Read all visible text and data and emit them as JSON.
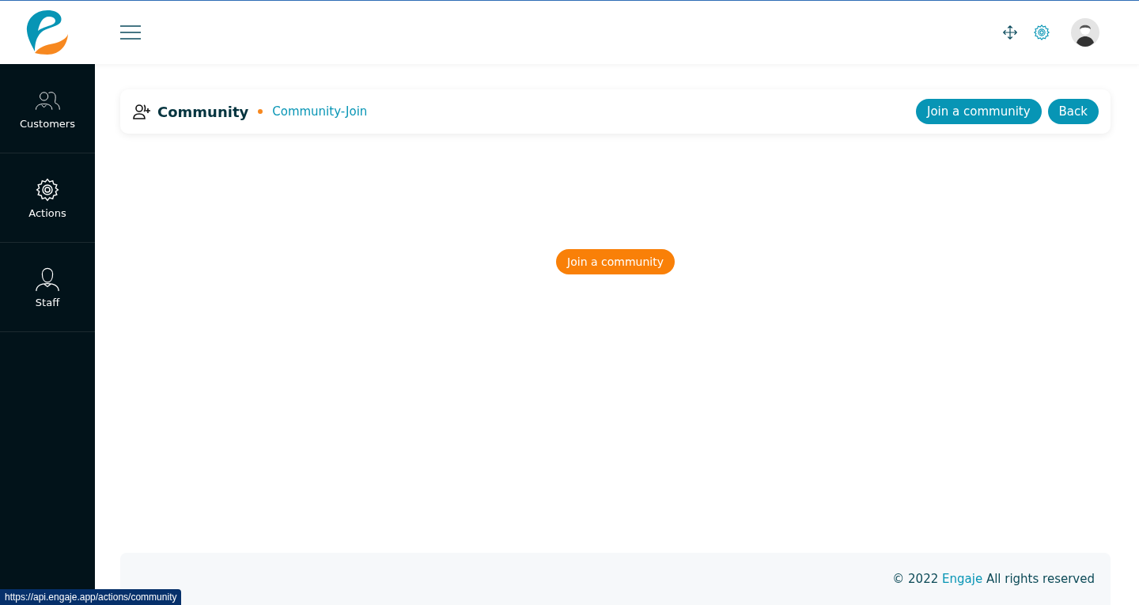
{
  "sidebar": {
    "items": [
      {
        "label": "Customers",
        "kind": "people"
      },
      {
        "label": "Actions",
        "kind": "gear"
      },
      {
        "label": "Staff",
        "kind": "person"
      }
    ]
  },
  "header": {
    "title": "Community",
    "breadcrumb": "Community-Join",
    "buttons": [
      "Join a community",
      "Back"
    ]
  },
  "main": {
    "button": "Join a community"
  },
  "footer": {
    "prefix": "© 2022",
    "brand": "Engaje",
    "suffix": "All rights reserved"
  },
  "status_link": "https://api.engaje.app/actions/community"
}
